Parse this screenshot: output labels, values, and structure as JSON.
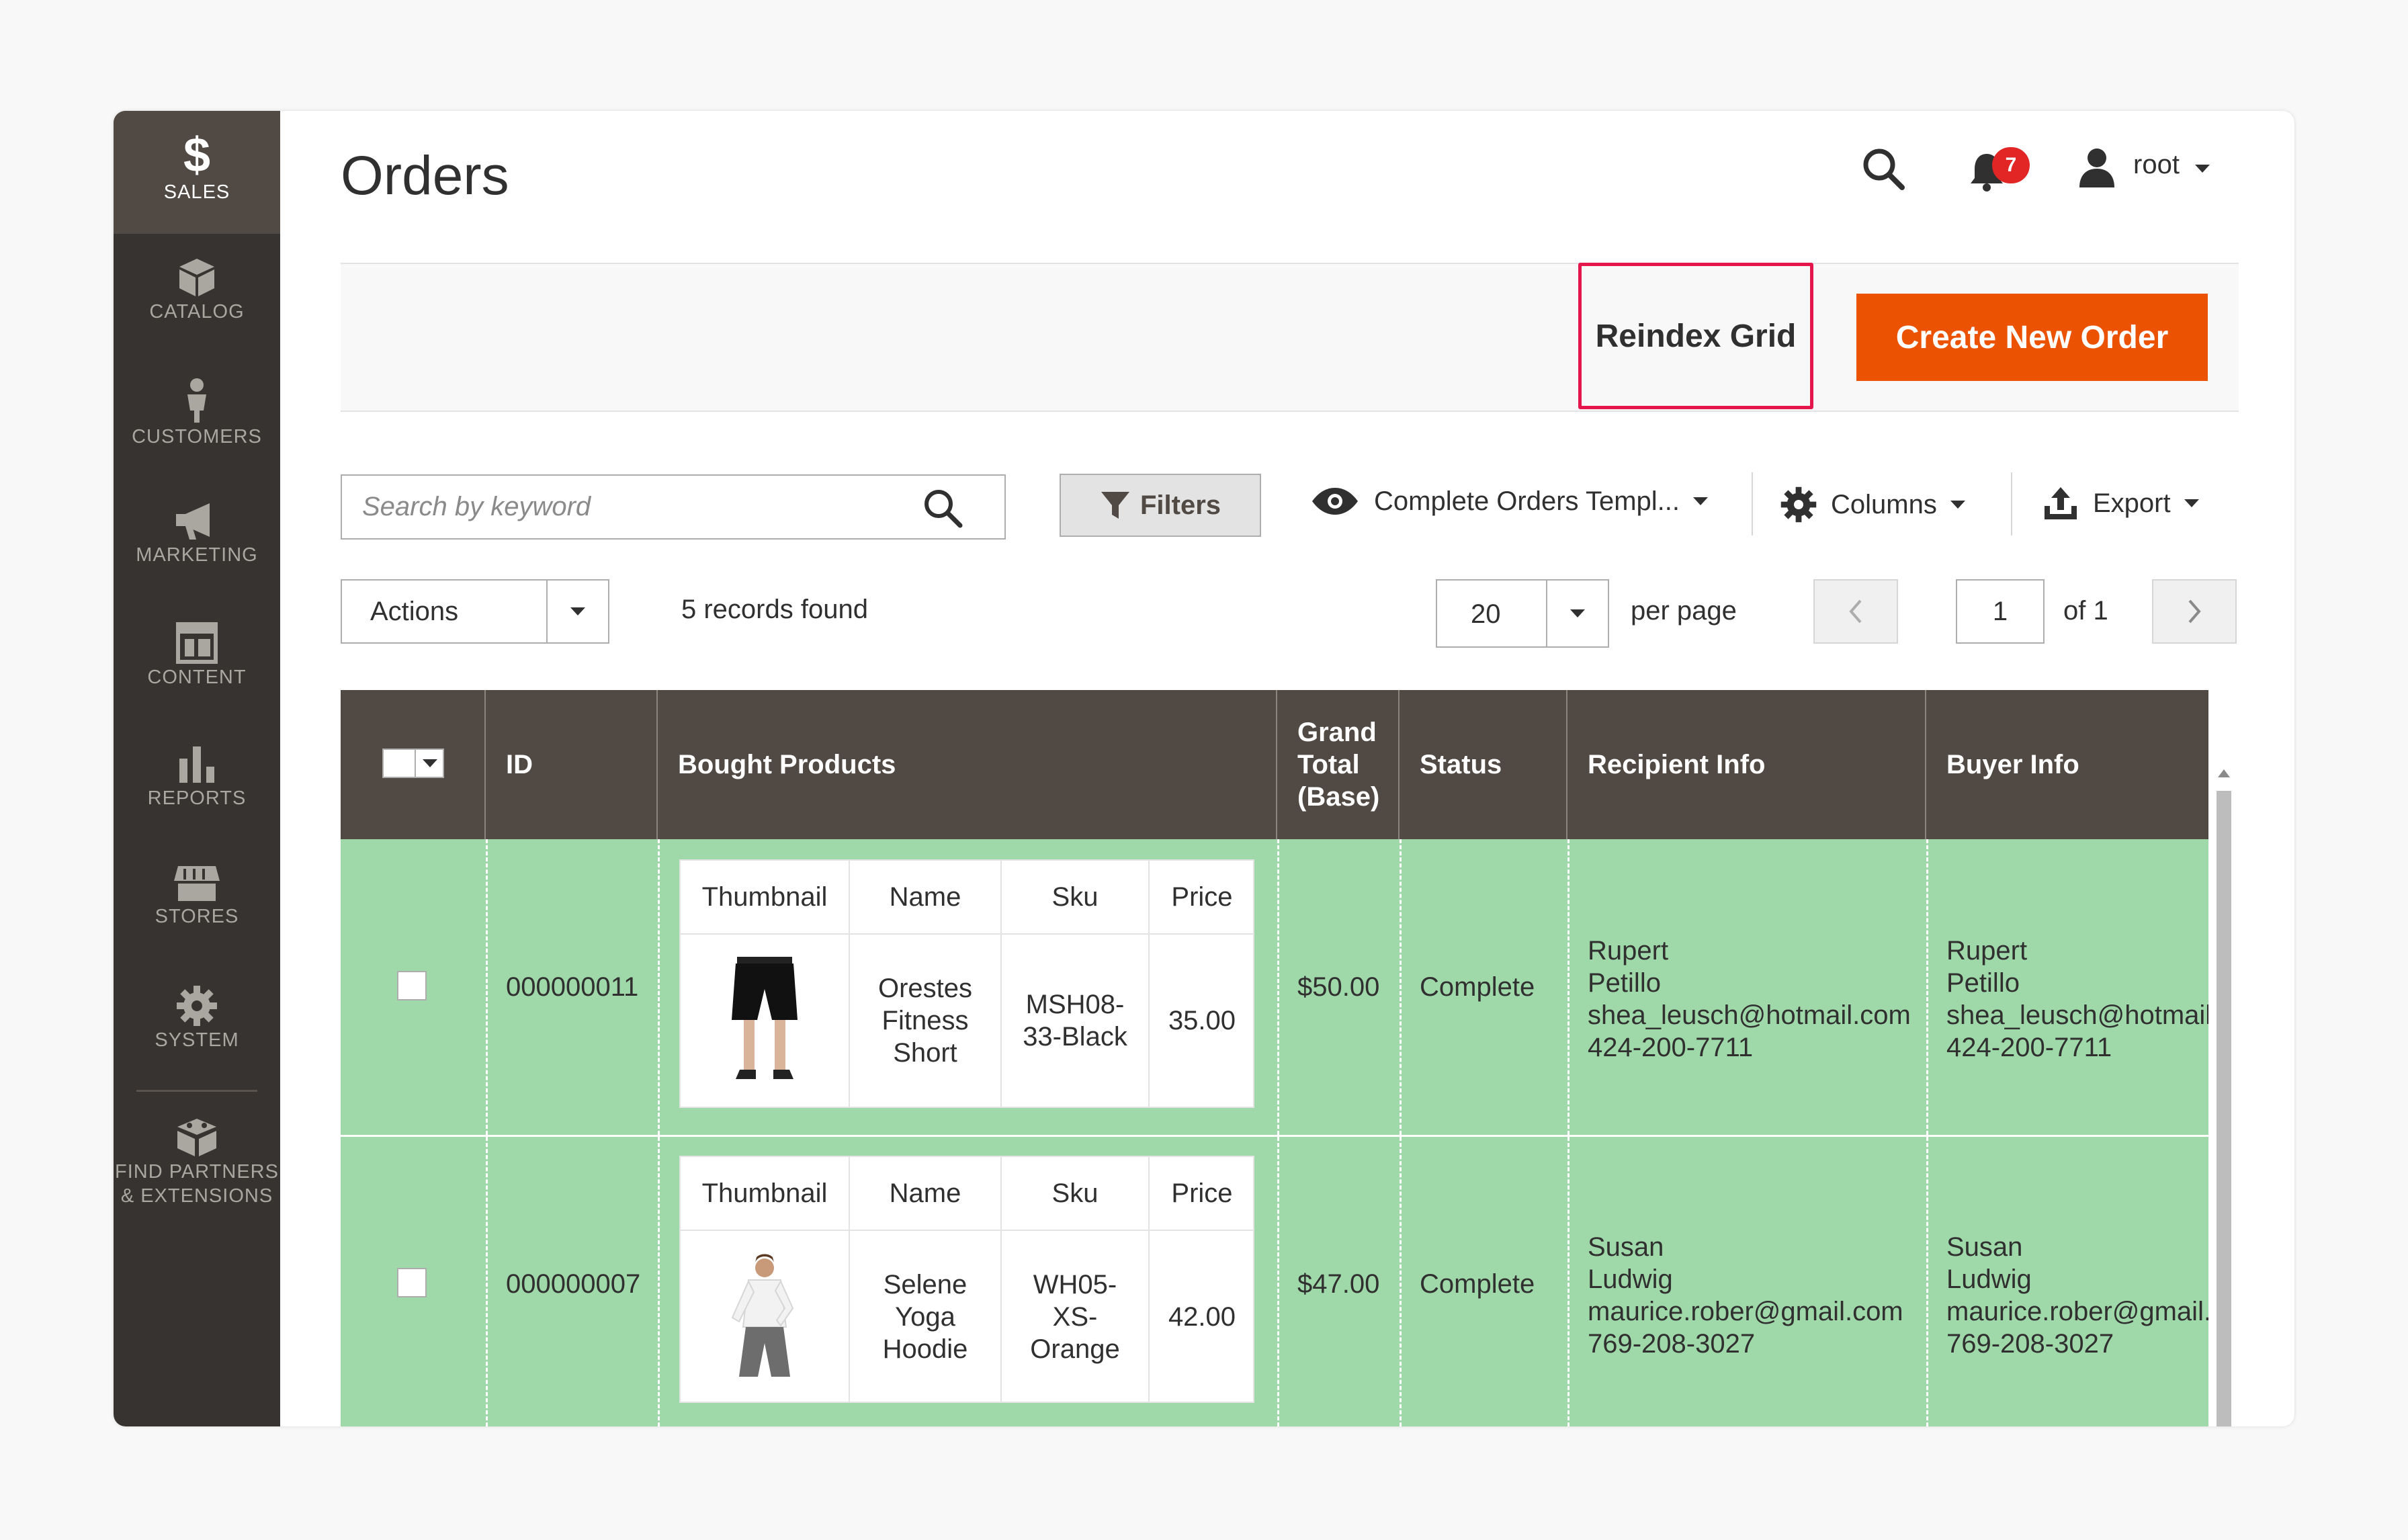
{
  "sidebar": {
    "items": [
      {
        "label": "SALES",
        "icon": "dollar-icon"
      },
      {
        "label": "CATALOG",
        "icon": "cube-icon"
      },
      {
        "label": "CUSTOMERS",
        "icon": "person-icon"
      },
      {
        "label": "MARKETING",
        "icon": "megaphone-icon"
      },
      {
        "label": "CONTENT",
        "icon": "layout-icon"
      },
      {
        "label": "REPORTS",
        "icon": "bar-chart-icon"
      },
      {
        "label": "STORES",
        "icon": "storefront-icon"
      },
      {
        "label": "SYSTEM",
        "icon": "gear-icon"
      },
      {
        "label_line1": "FIND PARTNERS",
        "label_line2": "& EXTENSIONS",
        "icon": "blocks-icon"
      }
    ]
  },
  "header": {
    "title": "Orders",
    "notification_count": "7",
    "user": "root"
  },
  "action_bar": {
    "reindex_label": "Reindex Grid",
    "create_label": "Create New Order"
  },
  "toolbar": {
    "search_placeholder": "Search by keyword",
    "filters_label": "Filters",
    "view_label": "Complete Orders Templ...",
    "columns_label": "Columns",
    "export_label": "Export",
    "actions_label": "Actions",
    "records_found": "5 records found",
    "per_page_value": "20",
    "per_page_label": "per page",
    "current_page": "1",
    "page_of": "of 1"
  },
  "grid": {
    "columns": {
      "id": "ID",
      "bought_products": "Bought Products",
      "grand_total_line1": "Grand",
      "grand_total_line2": "Total",
      "grand_total_line3": "(Base)",
      "status": "Status",
      "recipient": "Recipient Info",
      "buyer": "Buyer Info"
    },
    "inner_columns": {
      "thumbnail": "Thumbnail",
      "name": "Name",
      "sku": "Sku",
      "price": "Price"
    },
    "rows": [
      {
        "id": "000000011",
        "product_name_lines": [
          "Orestes",
          "Fitness",
          "Short"
        ],
        "sku_lines": [
          "MSH08-",
          "33-Black"
        ],
        "price": "35.00",
        "grand_total": "$50.00",
        "status": "Complete",
        "recipient": {
          "first": "Rupert",
          "last": "Petillo",
          "email": "shea_leusch@hotmail.com",
          "phone": "424-200-7711"
        },
        "buyer": {
          "first": "Rupert",
          "last": "Petillo",
          "email": "shea_leusch@hotmail.",
          "phone": "424-200-7711"
        }
      },
      {
        "id": "000000007",
        "product_name_lines": [
          "Selene",
          "Yoga",
          "Hoodie"
        ],
        "sku_lines": [
          "WH05-",
          "XS-",
          "Orange"
        ],
        "price": "42.00",
        "grand_total": "$47.00",
        "status": "Complete",
        "recipient": {
          "first": "Susan",
          "last": "Ludwig",
          "email": "maurice.rober@gmail.com",
          "phone": "769-208-3027"
        },
        "buyer": {
          "first": "Susan",
          "last": "Ludwig",
          "email": "maurice.rober@gmail.",
          "phone": "769-208-3027"
        }
      }
    ]
  },
  "colors": {
    "sidebar_bg": "#373330",
    "sidebar_active": "#514943",
    "primary_button": "#eb5202",
    "highlight_border": "#e4164c",
    "grid_header": "#514943",
    "row_highlight": "#a0d9a9",
    "badge": "#e22626"
  }
}
